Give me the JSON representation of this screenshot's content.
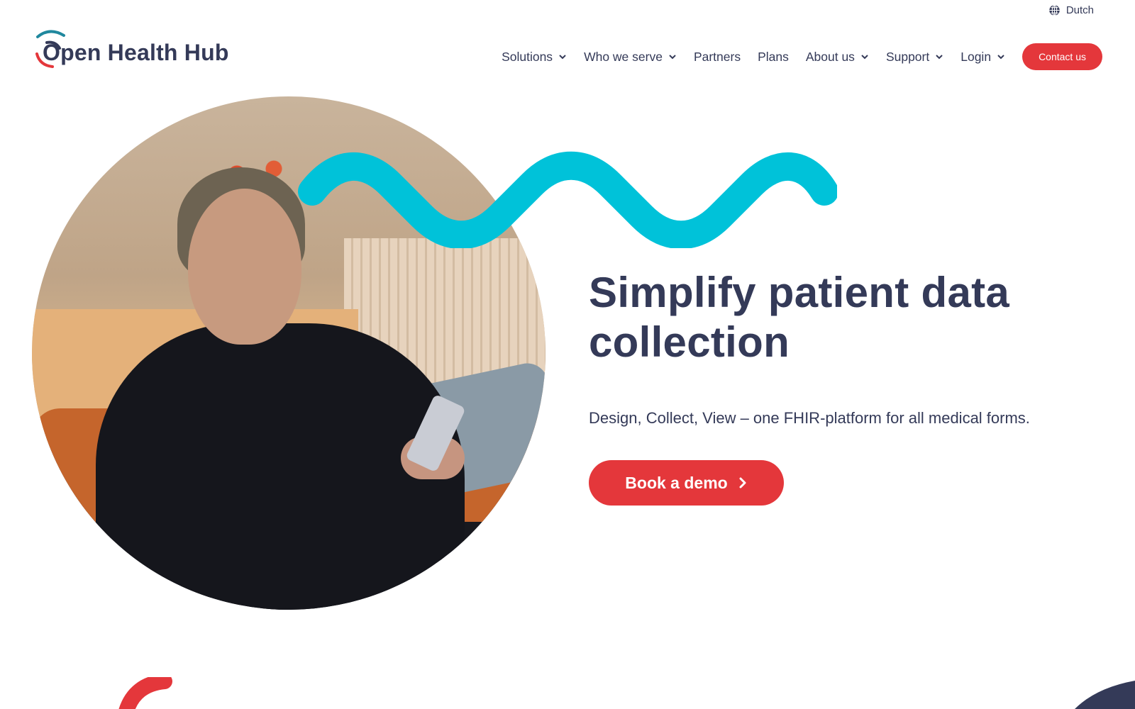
{
  "language": {
    "label": "Dutch",
    "icon": "globe-icon"
  },
  "brand": {
    "name": "Open Health Hub",
    "colors": {
      "navy": "#343a58",
      "red": "#e4373b",
      "teal": "#20889e",
      "cyan": "#00c2d9"
    }
  },
  "nav": {
    "items": [
      {
        "label": "Solutions",
        "has_dropdown": true
      },
      {
        "label": "Who we serve",
        "has_dropdown": true
      },
      {
        "label": "Partners",
        "has_dropdown": false
      },
      {
        "label": "Plans",
        "has_dropdown": false
      },
      {
        "label": "About us",
        "has_dropdown": true
      },
      {
        "label": "Support",
        "has_dropdown": true
      },
      {
        "label": "Login",
        "has_dropdown": true
      }
    ],
    "cta_label": "Contact us"
  },
  "hero": {
    "title": "Simplify patient data collection",
    "subtitle": "Design, Collect, View – one FHIR-platform for all medical forms.",
    "cta_label": "Book a demo",
    "image_alt": "Woman sitting on a sofa using a smartphone"
  }
}
